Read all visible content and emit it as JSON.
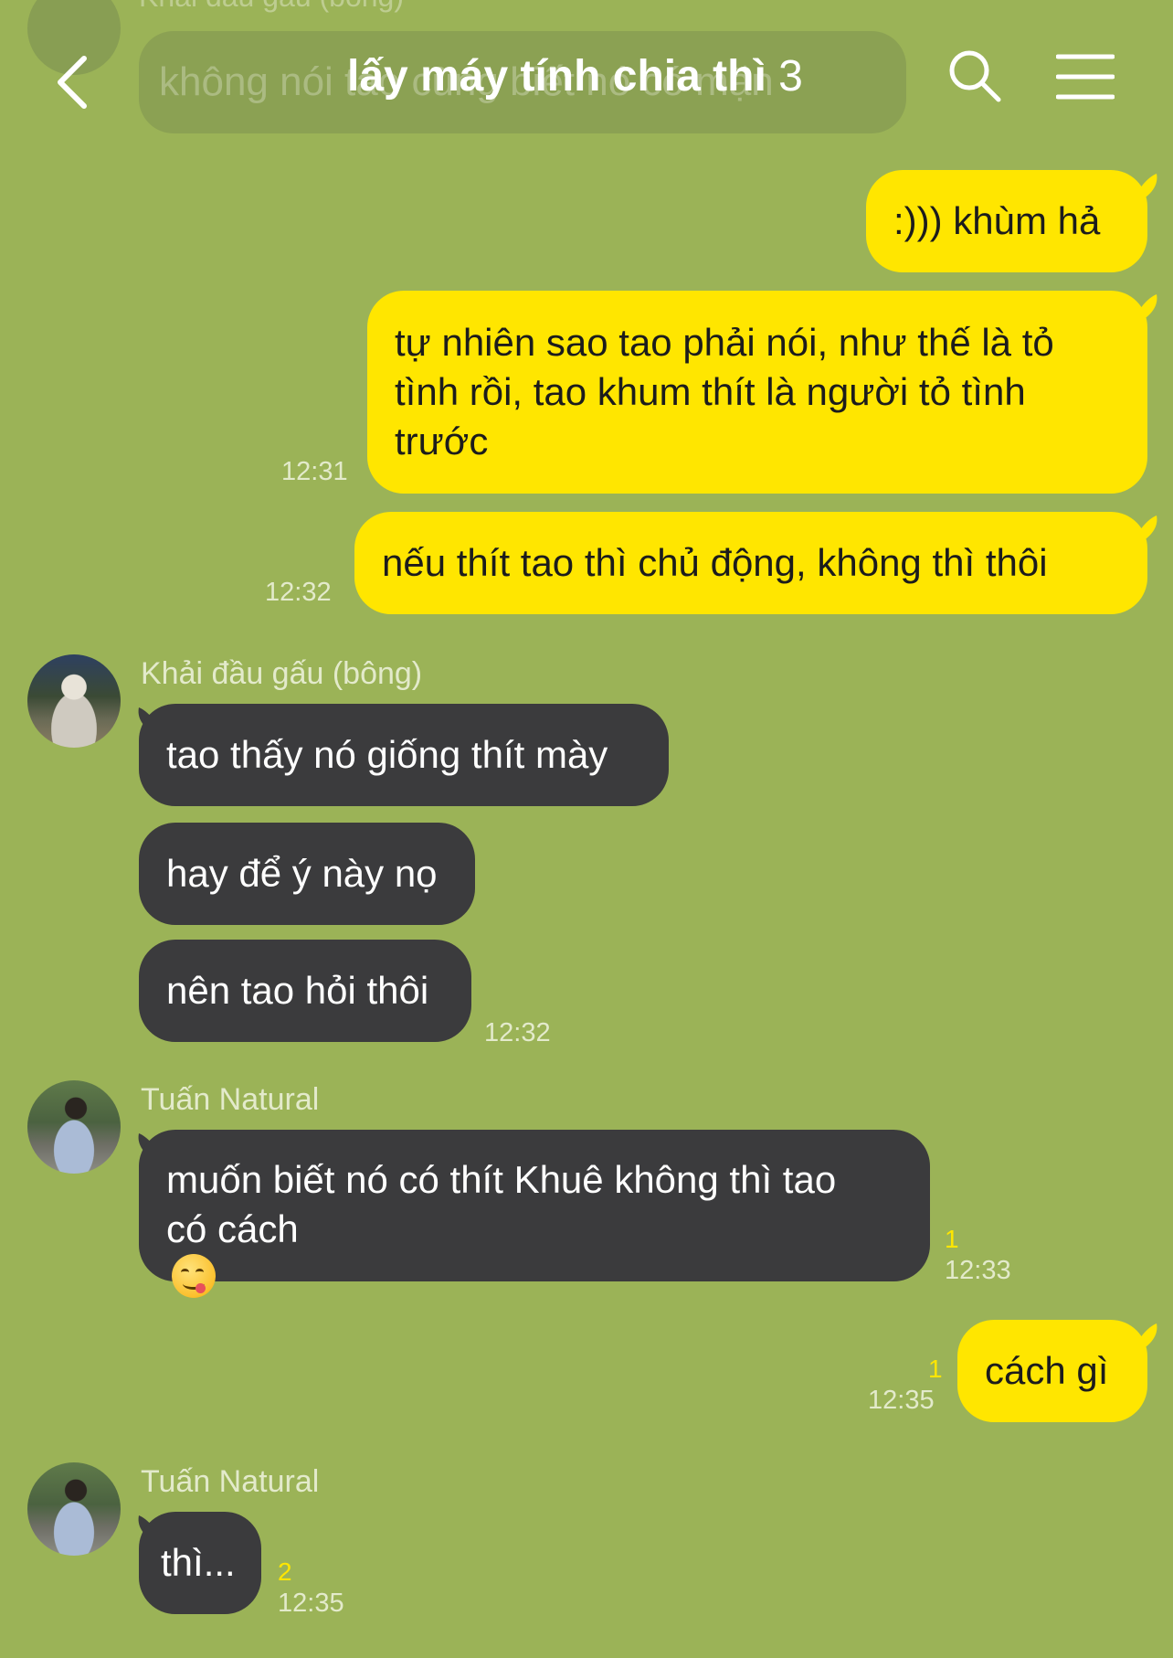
{
  "header": {
    "title": "lấy máy tính chia thì",
    "member_count": "3",
    "ghost_sender": "Khải đầu gấu (bông)",
    "ghost_message": "không nói tao cũng biết nó có mặn"
  },
  "messages": [
    {
      "type": "out",
      "text": ":))) khùm hả"
    },
    {
      "type": "out",
      "text": "tự nhiên sao tao phải nói, như thế là tỏ tình rồi, tao khum thít là người tỏ tình trước",
      "time": "12:31"
    },
    {
      "type": "out",
      "text": "nếu thít tao thì chủ động, không thì thôi",
      "time": "12:32"
    },
    {
      "type": "in",
      "sender": "Khải đầu gấu (bông)",
      "text": "tao thấy nó giống thít mày"
    },
    {
      "type": "in",
      "text": "hay để ý này nọ"
    },
    {
      "type": "in",
      "text": "nên tao hỏi thôi",
      "time": "12:32"
    },
    {
      "type": "in",
      "sender": "Tuấn Natural",
      "text_line1": "muốn biết nó có thít Khuê không thì tao",
      "text_line2": "có cách",
      "emoji": "yum-emoji",
      "unread": "1",
      "time": "12:33"
    },
    {
      "type": "out",
      "text": "cách gì",
      "unread": "1",
      "time": "12:35"
    },
    {
      "type": "in",
      "sender": "Tuấn Natural",
      "text": "thì...",
      "unread": "2",
      "time": "12:35"
    }
  ],
  "colors": {
    "background": "#9bb357",
    "outgoing_bubble": "#ffe600",
    "incoming_bubble": "#3b3b3d",
    "unread_count": "#ffe600"
  },
  "icons": [
    "back-arrow-icon",
    "search-icon",
    "menu-icon"
  ]
}
